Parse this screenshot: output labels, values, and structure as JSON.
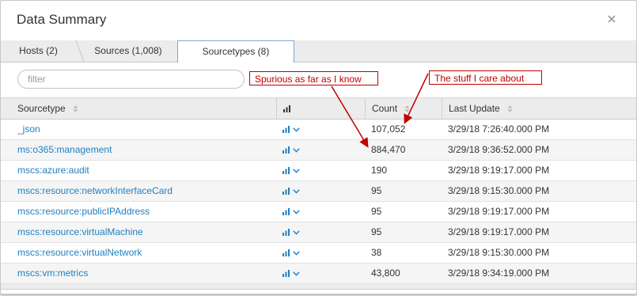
{
  "dialog": {
    "title": "Data Summary"
  },
  "tabs": [
    {
      "label": "Hosts (2)"
    },
    {
      "label": "Sources (1,008)"
    },
    {
      "label": "Sourcetypes (8)"
    }
  ],
  "filter": {
    "placeholder": "filter",
    "value": ""
  },
  "table": {
    "columns": [
      "Sourcetype",
      "",
      "Count",
      "Last Update"
    ],
    "rows": [
      {
        "sourcetype": "_json",
        "count": "107,052",
        "last_update": "3/29/18 7:26:40.000 PM"
      },
      {
        "sourcetype": "ms:o365:management",
        "count": "884,470",
        "last_update": "3/29/18 9:36:52.000 PM"
      },
      {
        "sourcetype": "mscs:azure:audit",
        "count": "190",
        "last_update": "3/29/18 9:19:17.000 PM"
      },
      {
        "sourcetype": "mscs:resource:networkInterfaceCard",
        "count": "95",
        "last_update": "3/29/18 9:15:30.000 PM"
      },
      {
        "sourcetype": "mscs:resource:publicIPAddress",
        "count": "95",
        "last_update": "3/29/18 9:19:17.000 PM"
      },
      {
        "sourcetype": "mscs:resource:virtualMachine",
        "count": "95",
        "last_update": "3/29/18 9:19:17.000 PM"
      },
      {
        "sourcetype": "mscs:resource:virtualNetwork",
        "count": "38",
        "last_update": "3/29/18 9:15:30.000 PM"
      },
      {
        "sourcetype": "mscs:vm:metrics",
        "count": "43,800",
        "last_update": "3/29/18 9:34:19.000 PM"
      }
    ]
  },
  "annotations": {
    "spurious": "Spurious as far as I know",
    "care": "The stuff I care about"
  },
  "icons": {
    "close": "close-icon",
    "sort": "sort-icon",
    "chart": "bar-chart-icon",
    "dropdown": "chevron-down-icon"
  },
  "colors": {
    "link": "#1e7fc1",
    "annotation": "#c00000",
    "active_tab_border": "#7aa9d6"
  }
}
